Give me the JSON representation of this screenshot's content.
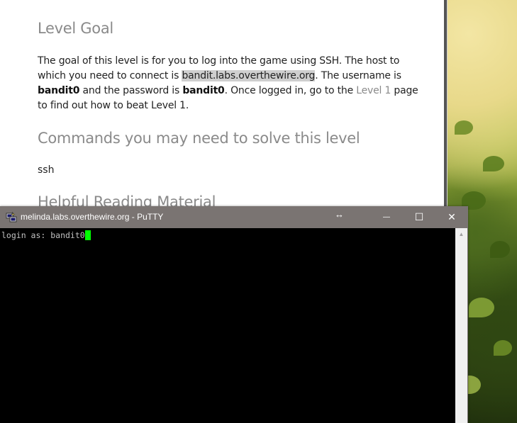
{
  "webpage": {
    "goal_heading": "Level Goal",
    "goal_text_1": "The goal of this level is for you to log into the game using SSH. The host to which you need to connect is ",
    "host": "bandit.labs.overthewire.org",
    "goal_text_2": ". The username is ",
    "username": "bandit0",
    "goal_text_3": " and the password is ",
    "password": "bandit0",
    "goal_text_4": ". Once logged in, go to the ",
    "level_link": "Level 1",
    "goal_text_5": " page to find out how to beat Level 1.",
    "commands_heading": "Commands you may need to solve this level",
    "command": "ssh",
    "reading_heading": "Helpful Reading Material"
  },
  "putty": {
    "title": "melinda.labs.overthewire.org - PuTTY",
    "move_glyph": "↔",
    "minimize_glyph": "—",
    "maximize_glyph": "☐",
    "close_glyph": "✕",
    "terminal_prompt": "login as: bandit0"
  },
  "colors": {
    "terminal_bg": "#000000",
    "cursor": "#00ff00",
    "titlebar": "#7a7472"
  }
}
